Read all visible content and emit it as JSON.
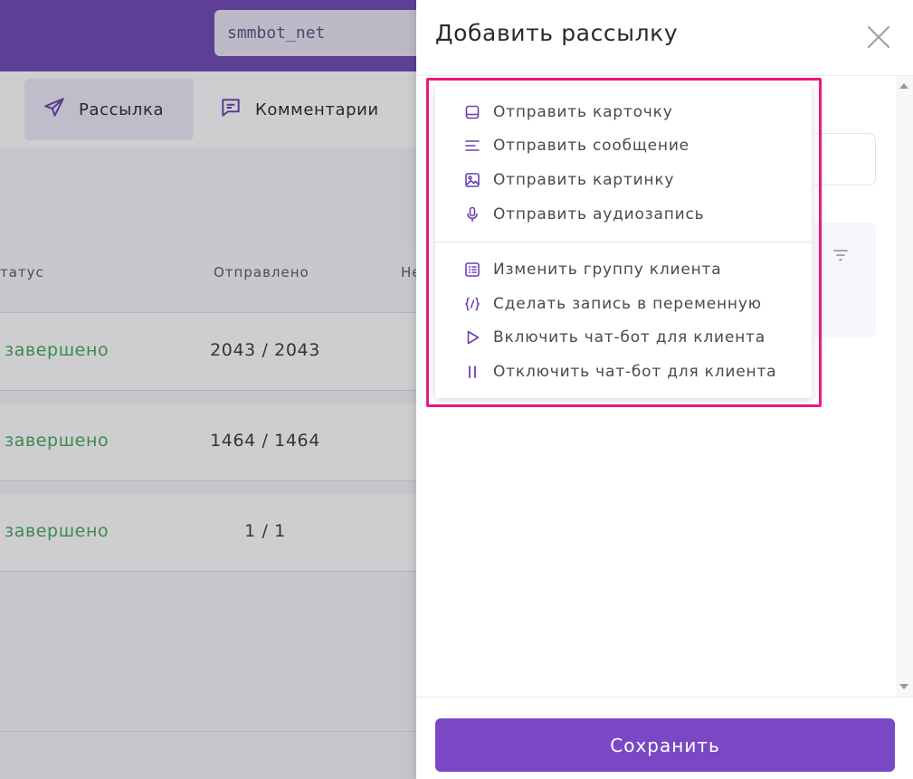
{
  "colors": {
    "brand": "#6a40b2",
    "accent": "#7a48c4",
    "success": "#3fa34d",
    "highlight": "#ea1a82"
  },
  "header": {
    "account": "smmbot_net"
  },
  "nav": {
    "tabs": [
      {
        "label": "Рассылка",
        "icon": "send-icon",
        "active": true
      },
      {
        "label": "Комментарии",
        "icon": "comment-icon",
        "active": false
      }
    ]
  },
  "table": {
    "columns": [
      "татус",
      "Отправлено",
      "Не"
    ],
    "rows": [
      {
        "status": "завершено",
        "sent": "2043 / 2043"
      },
      {
        "status": "завершено",
        "sent": "1464 / 1464"
      },
      {
        "status": "завершено",
        "sent": "1 / 1"
      }
    ]
  },
  "drawer": {
    "title": "Добавить рассылку",
    "save_label": "Сохранить"
  },
  "menu": {
    "group1": [
      {
        "label": "Отправить карточку",
        "icon": "card-icon"
      },
      {
        "label": "Отправить сообщение",
        "icon": "text-lines-icon"
      },
      {
        "label": "Отправить картинку",
        "icon": "image-icon"
      },
      {
        "label": "Отправить аудиозапись",
        "icon": "microphone-icon"
      }
    ],
    "group2": [
      {
        "label": "Изменить группу клиента",
        "icon": "group-list-icon"
      },
      {
        "label": "Сделать запись в переменную",
        "icon": "variable-icon"
      },
      {
        "label": "Включить чат-бот для клиента",
        "icon": "play-icon"
      },
      {
        "label": "Отключить чат-бот для клиента",
        "icon": "pause-icon"
      }
    ]
  }
}
